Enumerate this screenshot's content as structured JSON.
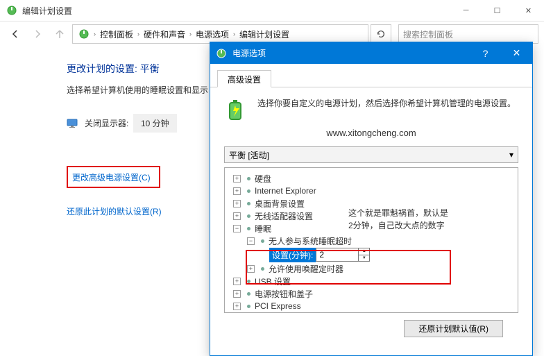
{
  "titlebar": {
    "title": "编辑计划设置"
  },
  "breadcrumbs": {
    "items": [
      "控制面板",
      "硬件和声音",
      "电源选项",
      "编辑计划设置"
    ]
  },
  "search": {
    "placeholder": "搜索控制面板"
  },
  "page": {
    "heading": "更改计划的设置: 平衡",
    "subtext": "选择希望计算机使用的睡眠设置和显示",
    "display_off_label": "关闭显示器:",
    "display_off_value": "10 分钟",
    "advanced_link": "更改高级电源设置(C)",
    "restore_link": "还原此计划的默认设置(R)"
  },
  "dialog": {
    "title": "电源选项",
    "tab": "高级设置",
    "description": "选择你要自定义的电源计划，然后选择你希望计算机管理的电源设置。",
    "url": "www.xitongcheng.com",
    "plan": "平衡 [活动]",
    "annotation_line1": "这个就是罪魁祸首，默认是",
    "annotation_line2": "2分钟，自己改大点的数字",
    "tree": {
      "harddisk": "硬盘",
      "ie": "Internet Explorer",
      "desktop_bg": "桌面背景设置",
      "wireless": "无线适配器设置",
      "sleep": "睡眠",
      "unattended": "无人参与系统睡眠超时",
      "setting_label": "设置(分钟):",
      "setting_value": "2",
      "wake_timers": "允许使用唤醒定时器",
      "usb": "USB 设置",
      "power_button": "电源按钮和盖子",
      "pci": "PCI Express"
    },
    "restore_button": "还原计划默认值(R)"
  }
}
